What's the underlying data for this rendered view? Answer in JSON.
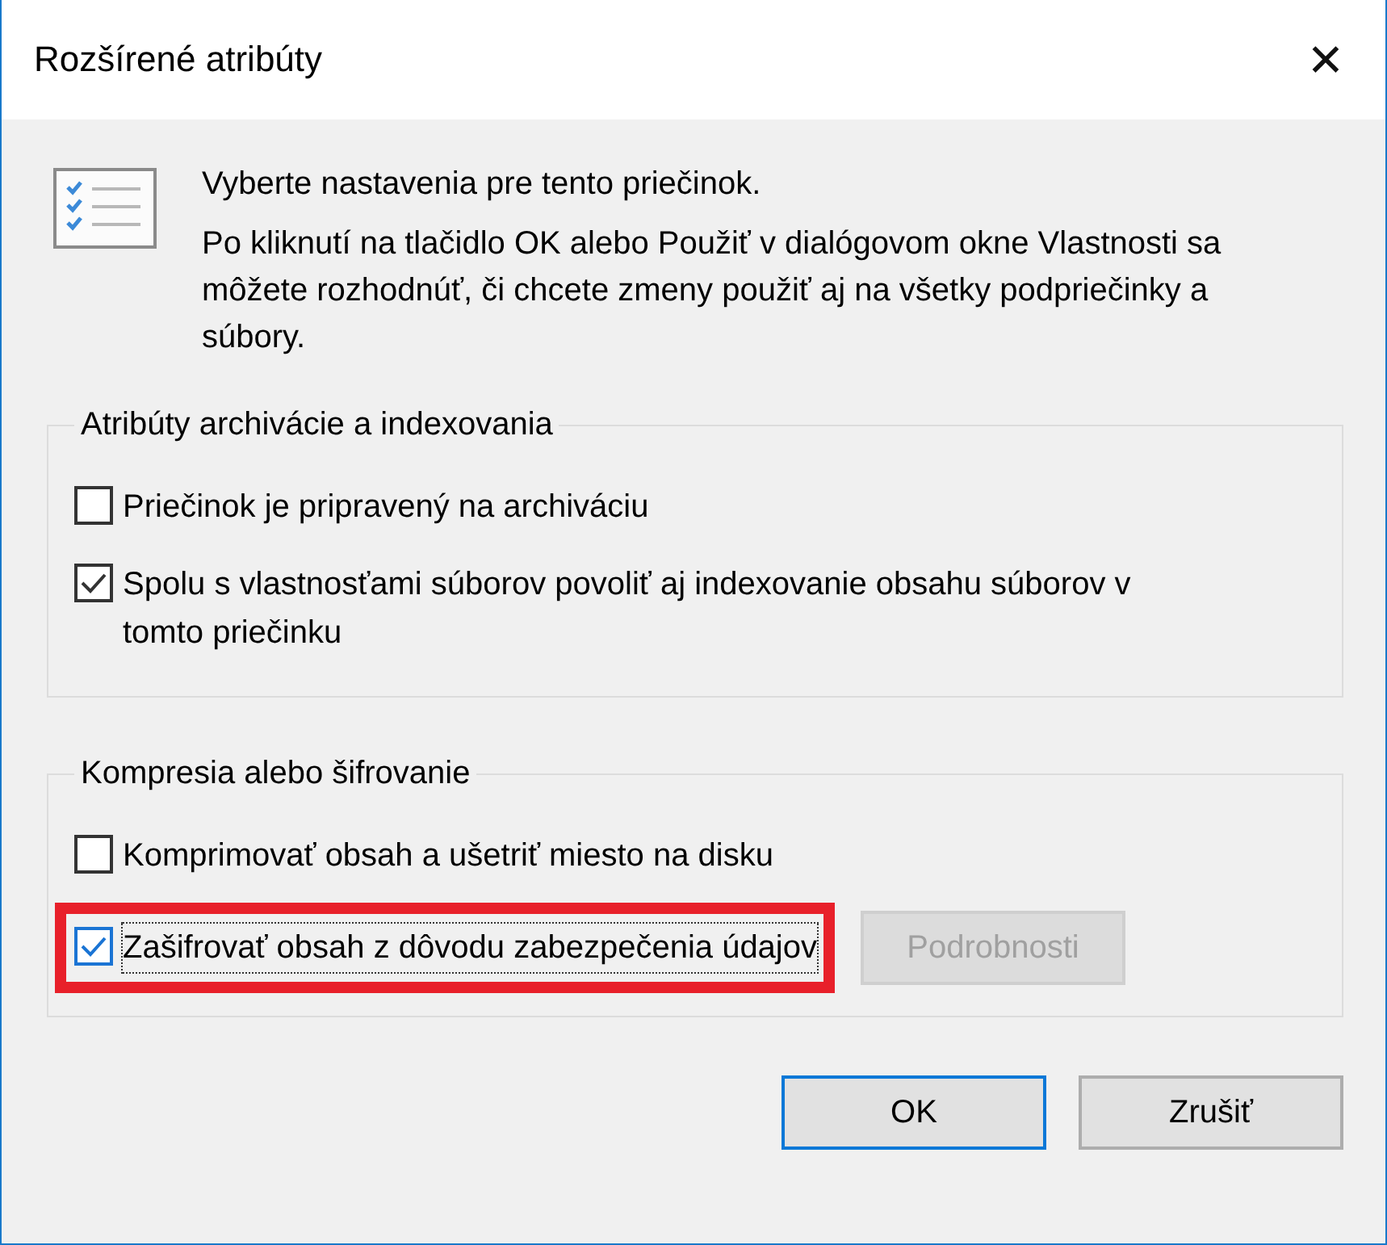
{
  "window": {
    "title": "Rozšírené atribúty",
    "close": "✕"
  },
  "intro": {
    "heading": "Vyberte nastavenia pre tento priečinok.",
    "text": "Po kliknutí na tlačidlo OK alebo Použiť v dialógovom okne Vlastnosti sa môžete rozhodnúť, či chcete zmeny použiť aj na všetky podpriečinky a súbory."
  },
  "groups": [
    {
      "title": "Atribúty archivácie a indexovania",
      "options": [
        {
          "label": "Priečinok je pripravený na archiváciu",
          "checked": false,
          "highlighted": false
        },
        {
          "label": "Spolu s vlastnosťami súborov povoliť aj indexovanie obsahu súborov v tomto priečinku",
          "checked": true,
          "highlighted": false
        }
      ]
    },
    {
      "title": "Kompresia alebo šifrovanie",
      "options": [
        {
          "label": "Komprimovať obsah a ušetriť miesto na disku",
          "checked": false,
          "highlighted": false
        },
        {
          "label": "Zašifrovať obsah z dôvodu zabezpečenia údajov",
          "checked": true,
          "highlighted": true,
          "button": {
            "label": "Podrobnosti",
            "disabled": true
          }
        }
      ]
    }
  ],
  "buttons": [
    {
      "label": "OK",
      "default": true
    },
    {
      "label": "Zrušiť",
      "default": false
    }
  ]
}
